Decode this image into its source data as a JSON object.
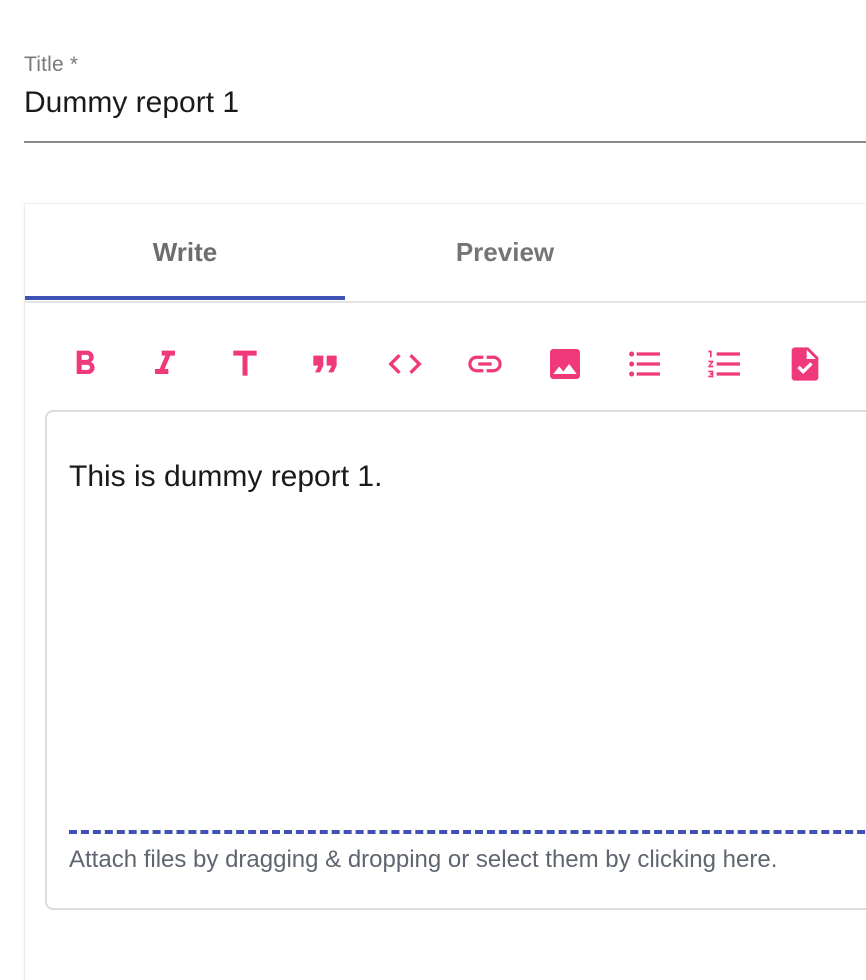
{
  "title_field": {
    "label": "Title *",
    "value": "Dummy report 1"
  },
  "editor": {
    "tabs": [
      {
        "label": "Write",
        "active": true
      },
      {
        "label": "Preview",
        "active": false
      }
    ],
    "toolbar": [
      {
        "name": "bold-icon"
      },
      {
        "name": "italic-icon"
      },
      {
        "name": "heading-icon"
      },
      {
        "name": "quote-icon"
      },
      {
        "name": "code-icon"
      },
      {
        "name": "link-icon"
      },
      {
        "name": "image-icon"
      },
      {
        "name": "bulleted-list-icon"
      },
      {
        "name": "numbered-list-icon"
      },
      {
        "name": "checked-document-icon"
      }
    ],
    "content": "This is dummy report 1.",
    "attach_hint": "Attach files by dragging & dropping or select them by clicking here."
  },
  "colors": {
    "icon": "#f0397a",
    "accent": "#3f51b5",
    "label": "#7a7a7a"
  }
}
